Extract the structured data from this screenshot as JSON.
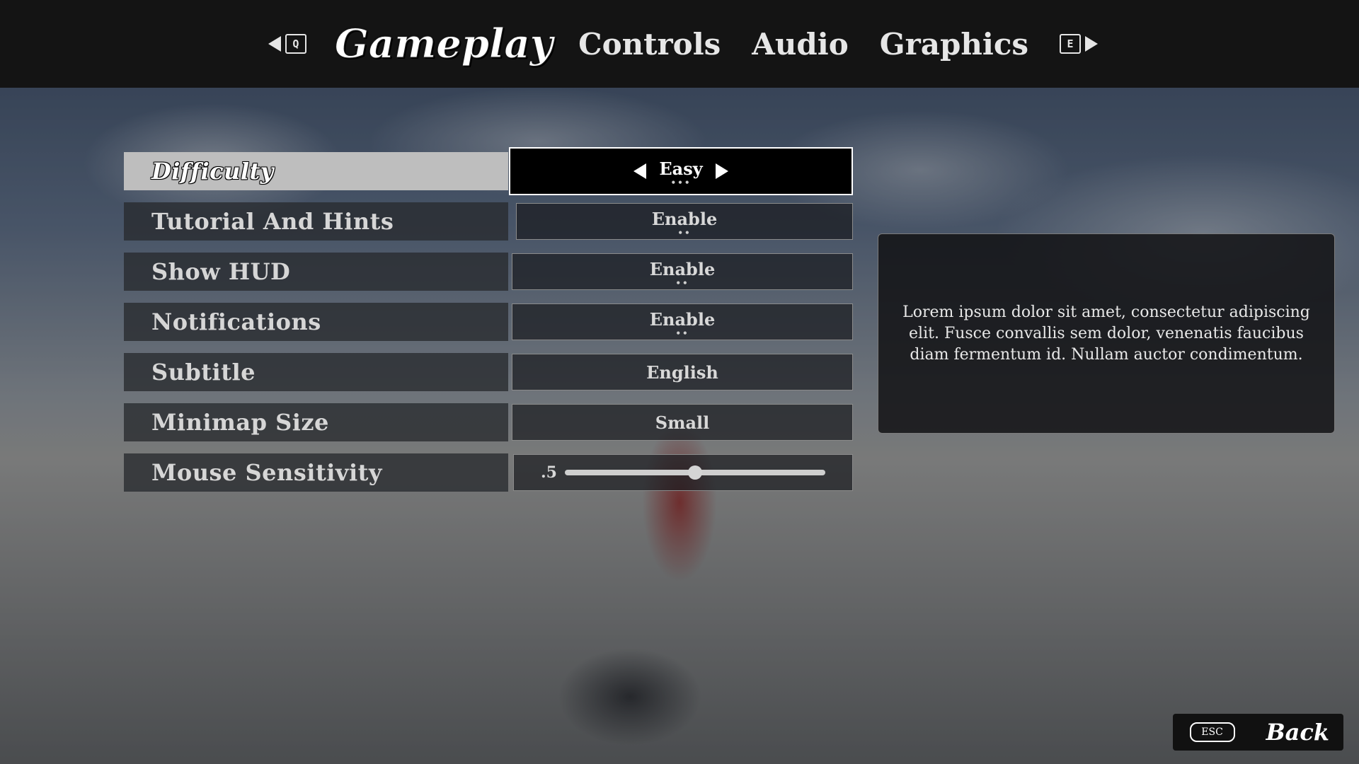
{
  "tabs": {
    "prev_key": "Q",
    "next_key": "E",
    "items": [
      {
        "label": "Gameplay",
        "active": true
      },
      {
        "label": "Controls",
        "active": false
      },
      {
        "label": "Audio",
        "active": false
      },
      {
        "label": "Graphics",
        "active": false
      }
    ]
  },
  "settings": [
    {
      "label": "Difficulty",
      "value": "Easy",
      "dots": "•••",
      "active": true
    },
    {
      "label": "Tutorial And Hints",
      "value": "Enable",
      "dots": "••"
    },
    {
      "label": "Show HUD",
      "value": "Enable",
      "dots": "••"
    },
    {
      "label": "Notifications",
      "value": "Enable",
      "dots": "••"
    },
    {
      "label": "Subtitle",
      "value": "English"
    },
    {
      "label": "Minimap Size",
      "value": "Small"
    },
    {
      "label": "Mouse Sensitivity",
      "slider_value": ".5",
      "slider_fraction": 0.5
    }
  ],
  "description": "Lorem ipsum dolor sit amet, consectetur adipiscing elit. Fusce convallis sem dolor, venenatis faucibus diam fermentum id. Nullam auctor condimentum.",
  "back": {
    "key": "ESC",
    "label": "Back"
  },
  "colors": {
    "panel": "#141414",
    "highlight": "#bebebe",
    "text": "#e6e6e6"
  }
}
